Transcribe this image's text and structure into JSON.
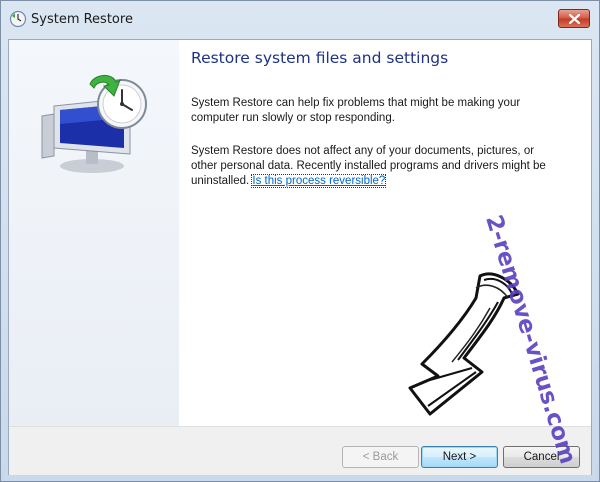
{
  "window": {
    "title": "System Restore",
    "icons": {
      "title": "system-restore-icon",
      "close": "close-icon",
      "hero": "system-restore-clock-icon"
    }
  },
  "content": {
    "heading": "Restore system files and settings",
    "paragraph1": "System Restore can help fix problems that might be making your computer run slowly or stop responding.",
    "paragraph2": "System Restore does not affect any of your documents, pictures, or other personal data. Recently installed programs and drivers might be uninstalled.",
    "link": "Is this process reversible?"
  },
  "buttons": {
    "back": "< Back",
    "next": "Next >",
    "cancel": "Cancel"
  },
  "overlay": {
    "watermark": "2-remove-virus.com",
    "arrow_icon": "hand-drawn-arrow-icon"
  },
  "colors": {
    "heading": "#1e3287",
    "link": "#0066cc",
    "close_button": "#c23b22",
    "watermark": "#5a3fc0"
  }
}
